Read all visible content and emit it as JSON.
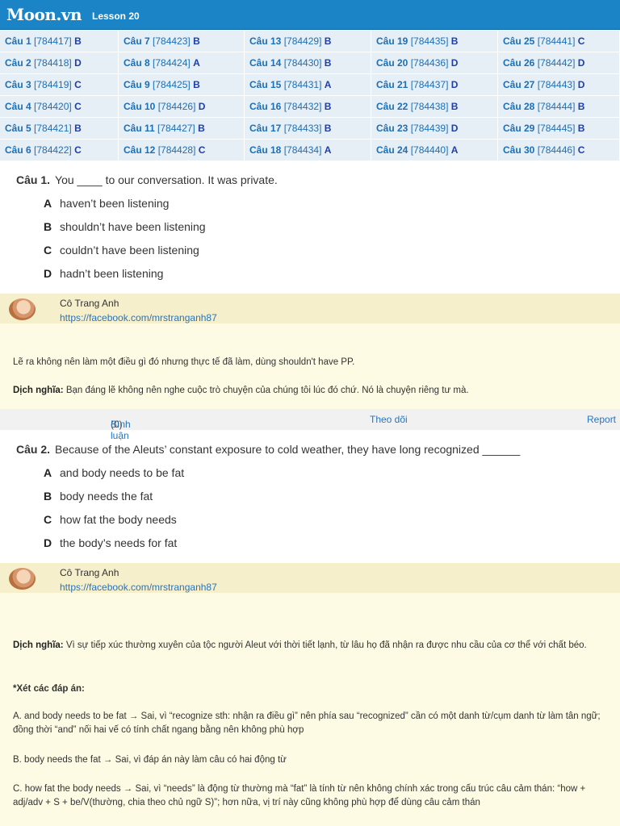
{
  "header": {
    "logo": "Moon.vn",
    "lesson": "Lesson 20"
  },
  "answer_grid": [
    [
      {
        "q": "Câu 1",
        "id": "[784417]",
        "a": "B"
      },
      {
        "q": "Câu 7",
        "id": "[784423]",
        "a": "B"
      },
      {
        "q": "Câu 13",
        "id": "[784429]",
        "a": "B"
      },
      {
        "q": "Câu 19",
        "id": "[784435]",
        "a": "B"
      },
      {
        "q": "Câu 25",
        "id": "[784441]",
        "a": "C"
      }
    ],
    [
      {
        "q": "Câu 2",
        "id": "[784418]",
        "a": "D"
      },
      {
        "q": "Câu 8",
        "id": "[784424]",
        "a": "A"
      },
      {
        "q": "Câu 14",
        "id": "[784430]",
        "a": "B"
      },
      {
        "q": "Câu 20",
        "id": "[784436]",
        "a": "D"
      },
      {
        "q": "Câu 26",
        "id": "[784442]",
        "a": "D"
      }
    ],
    [
      {
        "q": "Câu 3",
        "id": "[784419]",
        "a": "C"
      },
      {
        "q": "Câu 9",
        "id": "[784425]",
        "a": "B"
      },
      {
        "q": "Câu 15",
        "id": "[784431]",
        "a": "A"
      },
      {
        "q": "Câu 21",
        "id": "[784437]",
        "a": "D"
      },
      {
        "q": "Câu 27",
        "id": "[784443]",
        "a": "D"
      }
    ],
    [
      {
        "q": "Câu 4",
        "id": "[784420]",
        "a": "C"
      },
      {
        "q": "Câu 10",
        "id": "[784426]",
        "a": "D"
      },
      {
        "q": "Câu 16",
        "id": "[784432]",
        "a": "B"
      },
      {
        "q": "Câu 22",
        "id": "[784438]",
        "a": "B"
      },
      {
        "q": "Câu 28",
        "id": "[784444]",
        "a": "B"
      }
    ],
    [
      {
        "q": "Câu 5",
        "id": "[784421]",
        "a": "B"
      },
      {
        "q": "Câu 11",
        "id": "[784427]",
        "a": "B"
      },
      {
        "q": "Câu 17",
        "id": "[784433]",
        "a": "B"
      },
      {
        "q": "Câu 23",
        "id": "[784439]",
        "a": "D"
      },
      {
        "q": "Câu 29",
        "id": "[784445]",
        "a": "B"
      }
    ],
    [
      {
        "q": "Câu 6",
        "id": "[784422]",
        "a": "C"
      },
      {
        "q": "Câu 12",
        "id": "[784428]",
        "a": "C"
      },
      {
        "q": "Câu 18",
        "id": "[784434]",
        "a": "A"
      },
      {
        "q": "Câu 24",
        "id": "[784440]",
        "a": "A"
      },
      {
        "q": "Câu 30",
        "id": "[784446]",
        "a": "C"
      }
    ]
  ],
  "q1": {
    "label": "Câu 1.",
    "text": "You ____ to our conversation. It was private.",
    "options": [
      {
        "letter": "A",
        "text": "haven’t been listening"
      },
      {
        "letter": "B",
        "text": "shouldn’t have been listening"
      },
      {
        "letter": "C",
        "text": "couldn’t have been listening"
      },
      {
        "letter": "D",
        "text": "hadn’t been listening"
      }
    ]
  },
  "author": {
    "name": "Cô Trang Anh",
    "link": "https://facebook.com/mrstranganh87"
  },
  "sol1": {
    "line1": "Lẽ ra không nên làm một điều gì đó nhưng thực tế đã làm, dùng shouldn't have PP.",
    "trans_label": "Dịch nghĩa:",
    "trans_text": " Bạn đáng lẽ không nên nghe cuộc trò chuyện của chúng tôi lúc đó chứ. Nó là chuyện riêng tư mà."
  },
  "actions": {
    "count": "(0)",
    "comment": "Bình luận",
    "follow": "Theo dõi",
    "report": "Report"
  },
  "q2": {
    "label": "Câu 2.",
    "text": "Because of the Aleuts’ constant exposure to cold weather, they have long recognized ______",
    "options": [
      {
        "letter": "A",
        "text": "and body needs to be fat"
      },
      {
        "letter": "B",
        "text": "body needs the fat"
      },
      {
        "letter": "C",
        "text": "how fat the body needs"
      },
      {
        "letter": "D",
        "text": "the body’s needs for fat"
      }
    ]
  },
  "sol2": {
    "trans_label": "Dịch nghĩa:",
    "trans_text": " Vì sự tiếp xúc thường xuyên của tộc người Aleut với thời tiết lạnh, từ lâu họ đã nhận ra được nhu cầu của cơ thể với chất béo.",
    "review_heading": "*Xét các đáp án:",
    "para_a": "A. and body needs to be fat → Sai, vì “recognize sth: nhận ra điều gì” nên phía sau “recognized” cần có một danh từ/cụm danh từ làm tân ngữ; đồng thời “and” nối hai vế có tính chất ngang bằng nên không phù hợp",
    "para_b": "B. body needs the fat → Sai, vì đáp án này làm câu có hai động từ",
    "para_c": "C. how fat the body needs → Sai, vì “needs” là động từ thường mà “fat” là tính từ nên không chính xác trong cấu trúc câu cảm thán: “how + adj/adv + S + be/V(thường, chia theo chủ ngữ S)”; hơn nữa, vị trí này cũng không phù hợp để dùng câu cảm thán"
  }
}
